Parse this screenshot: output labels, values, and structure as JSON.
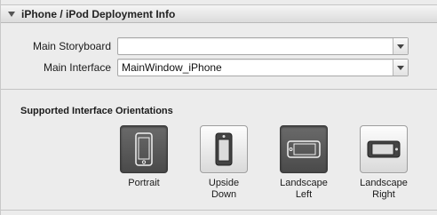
{
  "section": {
    "title": "iPhone / iPod Deployment Info"
  },
  "fields": {
    "main_storyboard": {
      "label": "Main Storyboard",
      "value": ""
    },
    "main_interface": {
      "label": "Main Interface",
      "value": "MainWindow_iPhone"
    }
  },
  "orientations": {
    "title": "Supported Interface Orientations",
    "items": [
      {
        "label": "Portrait",
        "selected": true,
        "icon": "device-portrait-icon"
      },
      {
        "label": "Upside\nDown",
        "selected": false,
        "icon": "device-upside-down-icon"
      },
      {
        "label": "Landscape\nLeft",
        "selected": true,
        "icon": "device-landscape-left-icon"
      },
      {
        "label": "Landscape\nRight",
        "selected": false,
        "icon": "device-landscape-right-icon"
      }
    ]
  },
  "colors": {
    "selected_button": "#555555",
    "unselected_button": "#eeeeee"
  }
}
